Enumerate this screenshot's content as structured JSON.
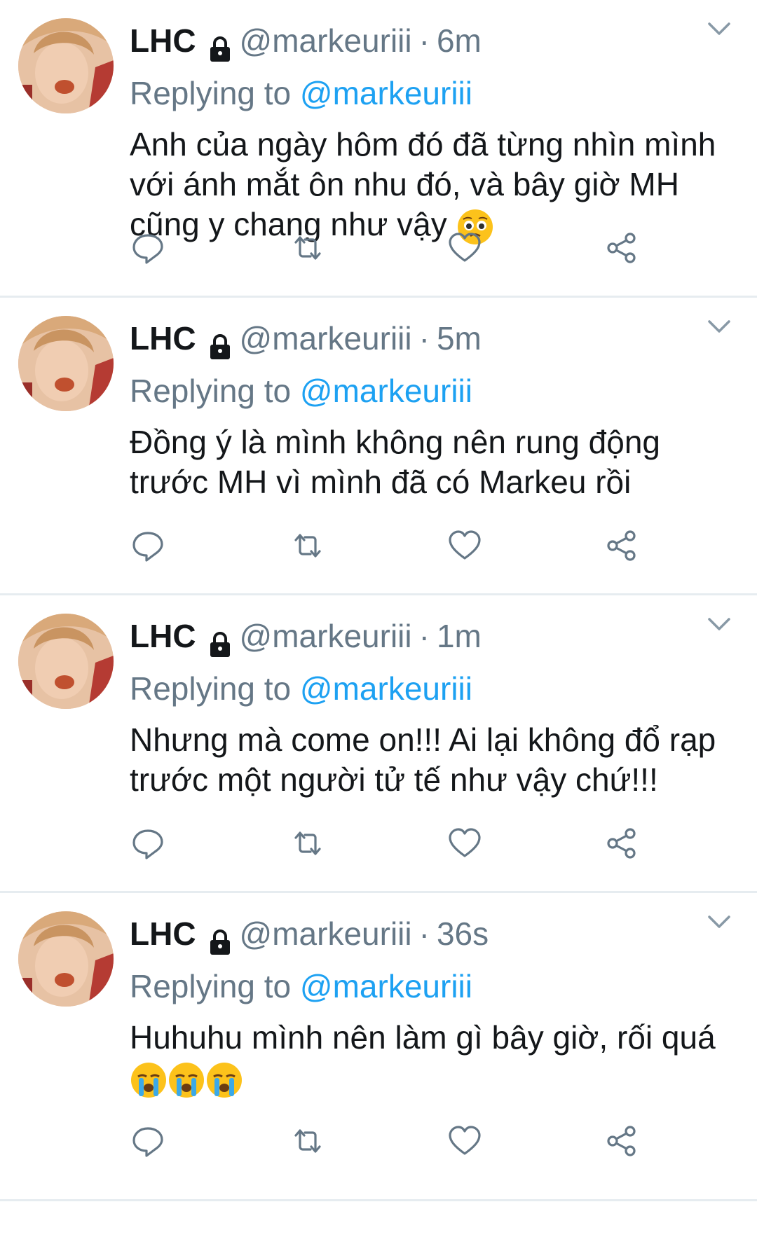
{
  "colors": {
    "link": "#1da1f2",
    "muted": "#657786",
    "text": "#14171a",
    "divider": "#e6ecf0"
  },
  "tweets": [
    {
      "name": "LHC",
      "handle": "@markeuriii",
      "separator": "·",
      "time": "6m",
      "replying_label": "Replying to ",
      "reply_to": "@markeuriii",
      "lines": [
        "Anh của ngày hôm đó đã từng nhìn mình",
        "với ánh mắt ôn nhu đó, và bây giờ MH",
        "cũng y chang như vậy"
      ],
      "emojis": [
        "pleading-face"
      ]
    },
    {
      "name": "LHC",
      "handle": "@markeuriii",
      "separator": "·",
      "time": "5m",
      "replying_label": "Replying to ",
      "reply_to": "@markeuriii",
      "lines": [
        "Đồng ý là mình không nên rung động",
        "trước MH vì mình đã có Markeu rồi"
      ],
      "emojis": []
    },
    {
      "name": "LHC",
      "handle": "@markeuriii",
      "separator": "·",
      "time": "1m",
      "replying_label": "Replying to ",
      "reply_to": "@markeuriii",
      "lines": [
        "Nhưng mà come on!!! Ai lại không đổ rạp",
        "trước một người tử tế như vậy chứ!!!"
      ],
      "emojis": []
    },
    {
      "name": "LHC",
      "handle": "@markeuriii",
      "separator": "·",
      "time": "36s",
      "replying_label": "Replying to ",
      "reply_to": "@markeuriii",
      "lines": [
        "Huhuhu mình nên làm gì bây giờ, rối quá"
      ],
      "emojis": [
        "loudly-crying-face",
        "loudly-crying-face",
        "loudly-crying-face"
      ]
    }
  ],
  "icons": {
    "lock": "lock-icon",
    "caret": "chevron-down-icon",
    "reply": "reply-icon",
    "retweet": "retweet-icon",
    "like": "heart-icon",
    "share": "share-icon"
  }
}
